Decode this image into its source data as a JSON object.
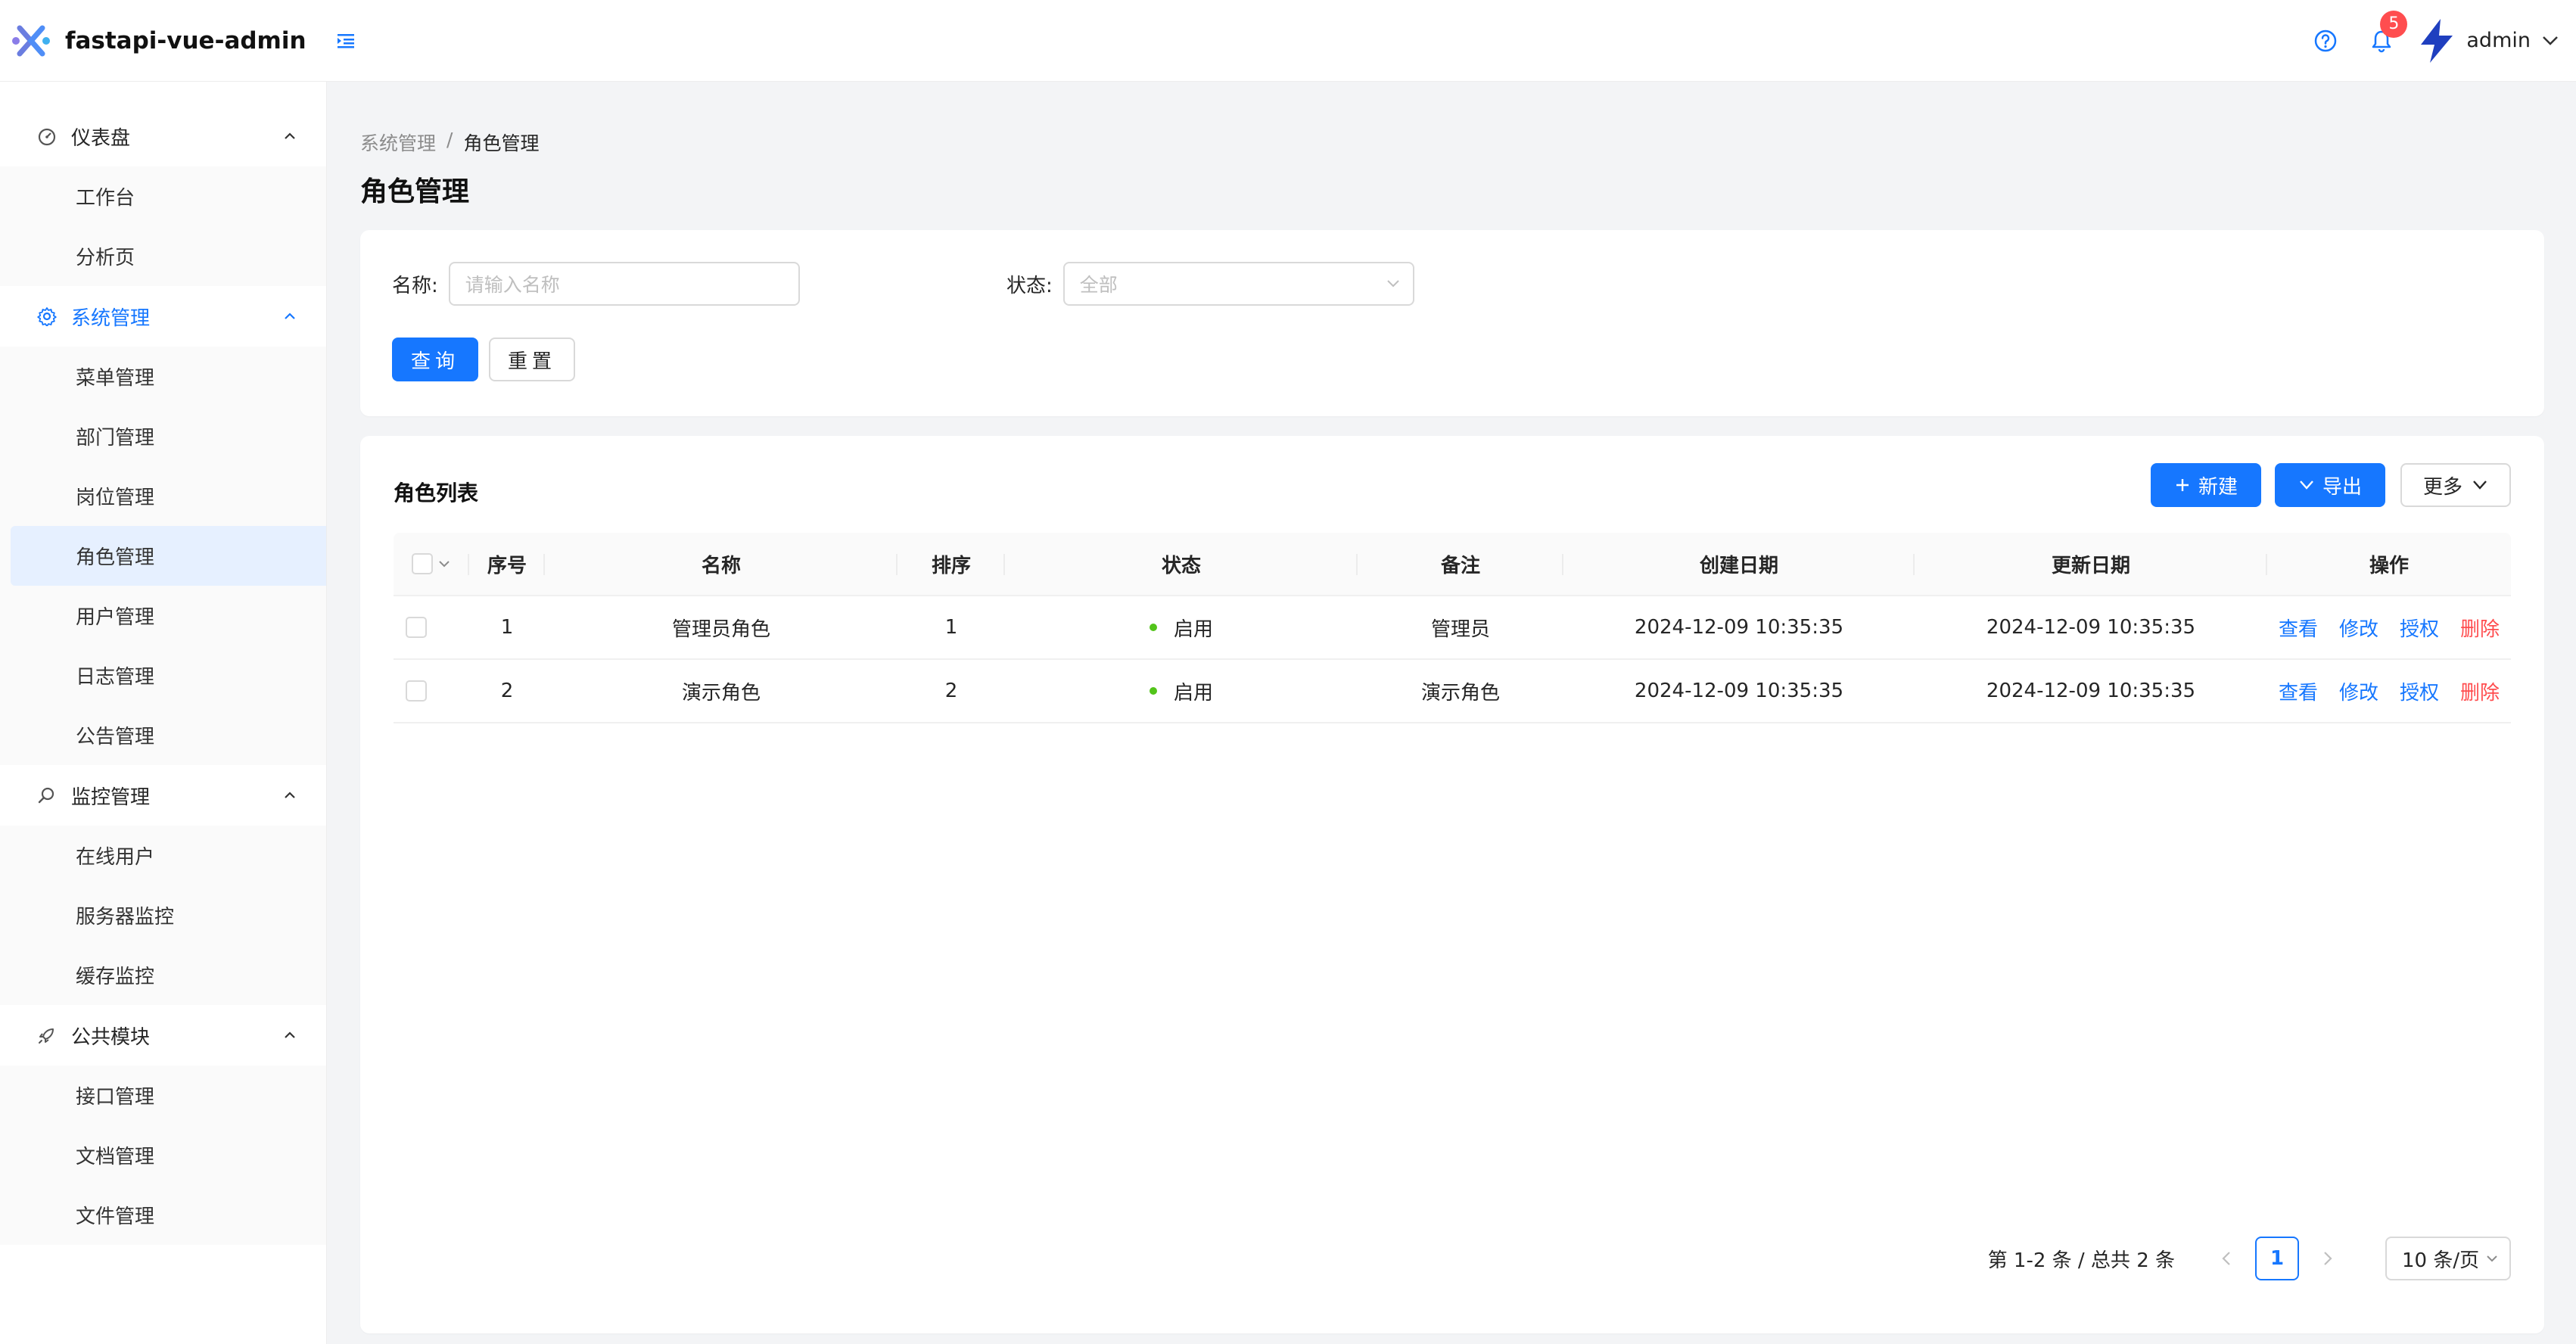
{
  "header": {
    "title": "fastapi-vue-admin",
    "notification_count": "5",
    "username": "admin"
  },
  "sidebar": {
    "groups": [
      {
        "label": "仪表盘",
        "icon": "dashboard-icon",
        "items": [
          "工作台",
          "分析页"
        ]
      },
      {
        "label": "系统管理",
        "icon": "gear-icon",
        "items": [
          "菜单管理",
          "部门管理",
          "岗位管理",
          "角色管理",
          "用户管理",
          "日志管理",
          "公告管理"
        ]
      },
      {
        "label": "监控管理",
        "icon": "monitor-icon",
        "items": [
          "在线用户",
          "服务器监控",
          "缓存监控"
        ]
      },
      {
        "label": "公共模块",
        "icon": "rocket-icon",
        "items": [
          "接口管理",
          "文档管理",
          "文件管理"
        ]
      }
    ],
    "active_item": "角色管理"
  },
  "breadcrumb": {
    "parent": "系统管理",
    "separator": "/",
    "current": "角色管理"
  },
  "page_title": "角色管理",
  "filter": {
    "name_label": "名称:",
    "name_placeholder": "请输入名称",
    "status_label": "状态:",
    "status_value": "全部",
    "query_label": "查询",
    "reset_label": "重置"
  },
  "table_card": {
    "title": "角色列表",
    "new_label": "新建",
    "export_label": "导出",
    "more_label": "更多"
  },
  "table": {
    "columns": [
      "序号",
      "名称",
      "排序",
      "状态",
      "备注",
      "创建日期",
      "更新日期",
      "操作"
    ],
    "rows": [
      {
        "index": "1",
        "name": "管理员角色",
        "order": "1",
        "status": "启用",
        "remark": "管理员",
        "created": "2024-12-09 10:35:35",
        "updated": "2024-12-09 10:35:35"
      },
      {
        "index": "2",
        "name": "演示角色",
        "order": "2",
        "status": "启用",
        "remark": "演示角色",
        "created": "2024-12-09 10:35:35",
        "updated": "2024-12-09 10:35:35"
      }
    ],
    "actions": {
      "view": "查看",
      "edit": "修改",
      "authorize": "授权",
      "delete": "删除"
    }
  },
  "pagination": {
    "total_text": "第 1-2 条 / 总共 2 条",
    "current_page": "1",
    "page_size": "10 条/页"
  },
  "colors": {
    "primary": "#1677ff",
    "danger": "#ff4d4f",
    "success": "#52c41a",
    "active_bg": "#e6f0ff"
  }
}
